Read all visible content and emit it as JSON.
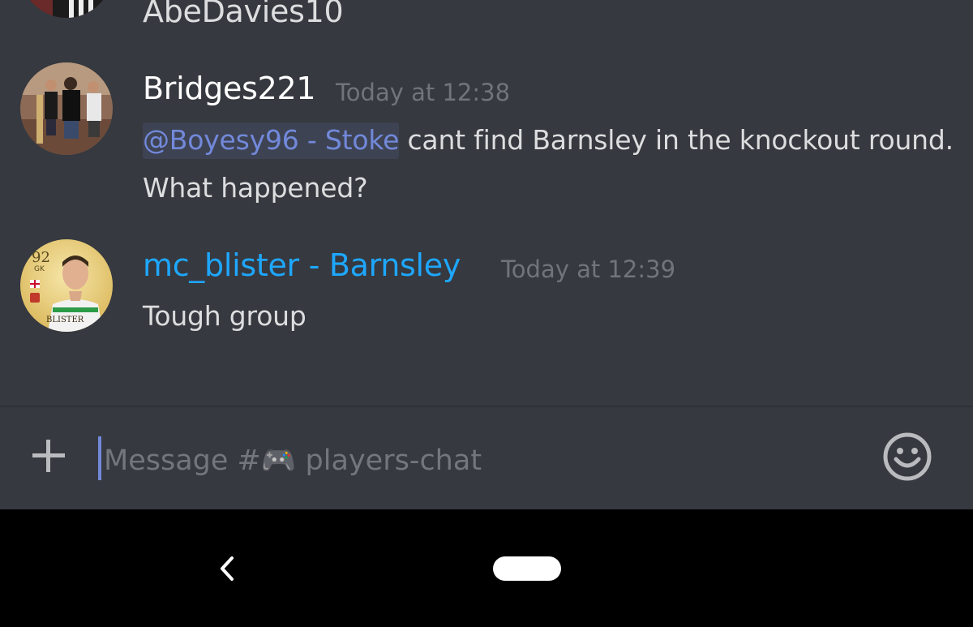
{
  "messages": {
    "previous": {
      "username": "AbeDavies10"
    },
    "first": {
      "username": "Bridges221",
      "timestamp": "Today at 12:38",
      "mention": "@Boyesy96 - Stoke",
      "line1_text": " cant find Barnsley in the knockout round.",
      "line2_text": "What happened?"
    },
    "second": {
      "username": "mc_blister - Barnsley",
      "username_color": "#1ea7ff",
      "timestamp": "Today at 12:39",
      "text": "Tough group",
      "avatar_card": {
        "rating": "92",
        "position": "GK",
        "label": "BLISTER"
      }
    }
  },
  "composer": {
    "placeholder": "Message #🎮 players-chat",
    "add_icon": "plus-icon",
    "emoji_icon": "smiley-icon"
  },
  "navbar": {
    "back_icon": "back-chevron-icon",
    "home_icon": "home-pill-icon"
  },
  "colors": {
    "background": "#36393f",
    "mention_text": "#7289da",
    "mention_bg": "#3e4354",
    "timestamp": "#71747a",
    "role_blue": "#1ea7ff"
  }
}
